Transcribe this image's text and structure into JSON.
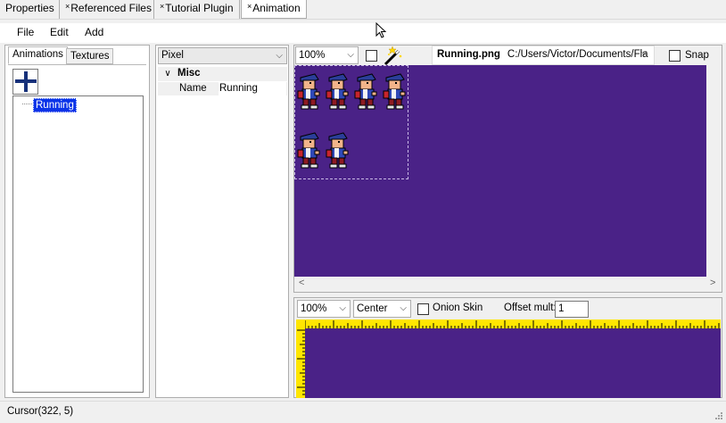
{
  "tabs": [
    {
      "label": "Properties",
      "closable": false
    },
    {
      "label": "Referenced Files",
      "closable": true
    },
    {
      "label": "Tutorial Plugin",
      "closable": true
    },
    {
      "label": "Animation",
      "closable": true,
      "active": true
    }
  ],
  "tab_close_glyph": "×",
  "menu": {
    "items": [
      "File",
      "Edit",
      "Add"
    ]
  },
  "left_panel": {
    "tabs": [
      "Animations",
      "Textures"
    ],
    "add_button_icon": "plus-icon",
    "tree_items": [
      "Running"
    ]
  },
  "property_grid": {
    "selected_object": "Pixel",
    "category": "Misc",
    "rows": [
      {
        "name": "Name",
        "value": "Running"
      }
    ]
  },
  "texture_editor": {
    "zoom": "100%",
    "wand_icon": "magic-wand-icon",
    "texture_file": "Running.png",
    "texture_path": "C:/Users/Victor/Documents/Fla",
    "snap_label": "Snap",
    "background_color": "#4a2287",
    "frames_row1": 4,
    "frames_row2": 2
  },
  "preview": {
    "zoom": "100%",
    "alignment": "Center",
    "onion_skin_label": "Onion Skin",
    "offset_mult_label": "Offset mult:",
    "offset_mult_value": "1",
    "ruler_color": "#ffe600"
  },
  "status": {
    "text": "Cursor(322, 5)"
  }
}
